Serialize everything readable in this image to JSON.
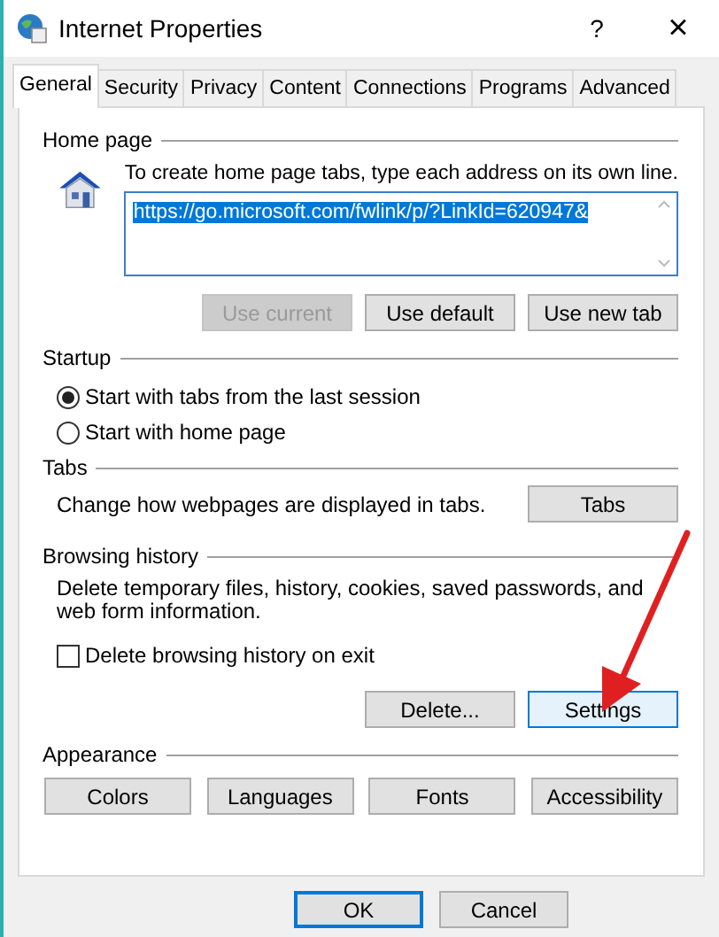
{
  "window": {
    "title": "Internet Properties",
    "help": "?",
    "close": "×"
  },
  "tabs": [
    {
      "label": "General",
      "selected": true
    },
    {
      "label": "Security",
      "selected": false
    },
    {
      "label": "Privacy",
      "selected": false
    },
    {
      "label": "Content",
      "selected": false
    },
    {
      "label": "Connections",
      "selected": false
    },
    {
      "label": "Programs",
      "selected": false
    },
    {
      "label": "Advanced",
      "selected": false
    }
  ],
  "home_page": {
    "title": "Home page",
    "hint": "To create home page tabs, type each address on its own line.",
    "value": "https://go.microsoft.com/fwlink/p/?LinkId=620947&",
    "buttons": [
      {
        "label": "Use current",
        "disabled": true
      },
      {
        "label": "Use default",
        "disabled": false
      },
      {
        "label": "Use new tab",
        "disabled": false
      }
    ]
  },
  "startup": {
    "title": "Startup",
    "options": [
      {
        "label": "Start with tabs from the last session",
        "selected": true
      },
      {
        "label": "Start with home page",
        "selected": false
      }
    ]
  },
  "tabs_section": {
    "title": "Tabs",
    "text": "Change how webpages are displayed in tabs.",
    "button": "Tabs"
  },
  "browsing_history": {
    "title": "Browsing history",
    "text": "Delete temporary files, history, cookies, saved passwords, and web form information.",
    "checkbox": {
      "label": "Delete browsing history on exit",
      "checked": false
    },
    "buttons": [
      {
        "label": "Delete...",
        "focused": false
      },
      {
        "label": "Settings",
        "focused": true
      }
    ]
  },
  "appearance": {
    "title": "Appearance",
    "buttons": [
      "Colors",
      "Languages",
      "Fonts",
      "Accessibility"
    ]
  },
  "footer": [
    {
      "label": "OK",
      "default": true
    },
    {
      "label": "Cancel",
      "default": false
    }
  ]
}
